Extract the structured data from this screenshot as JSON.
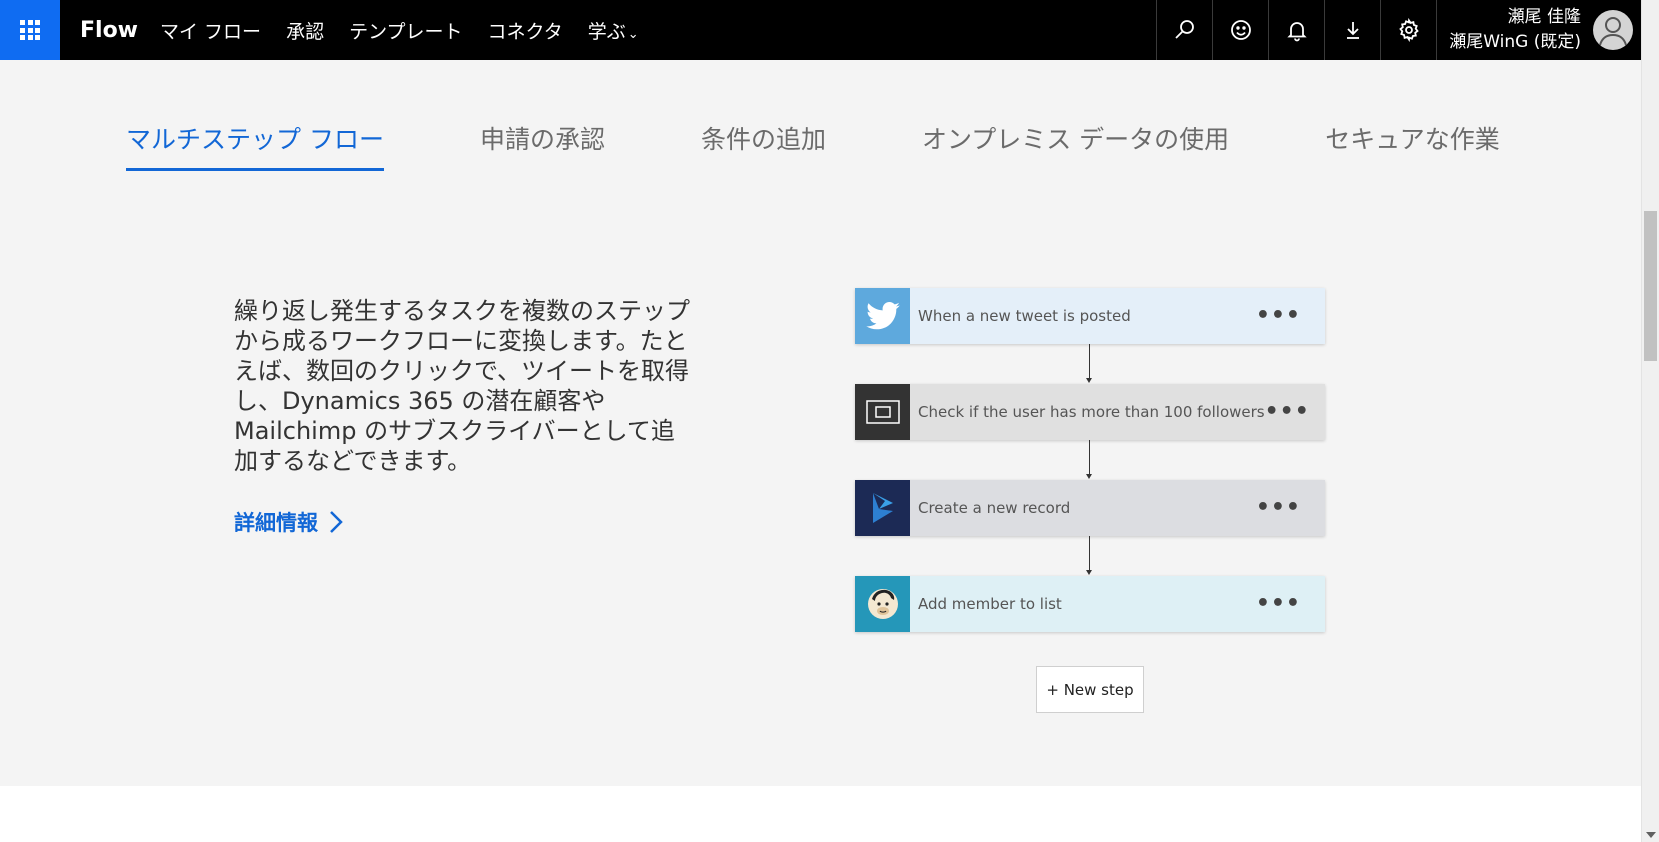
{
  "header": {
    "brand": "Flow",
    "nav": [
      {
        "label": "マイ フロー"
      },
      {
        "label": "承認"
      },
      {
        "label": "テンプレート"
      },
      {
        "label": "コネクタ"
      },
      {
        "label": "学ぶ",
        "has_dropdown": true
      }
    ],
    "icons": [
      "search-icon",
      "smiley-icon",
      "bell-icon",
      "download-icon",
      "gear-icon"
    ],
    "user": {
      "name": "瀬尾 佳隆",
      "org": "瀬尾WinG (既定)"
    },
    "colors": {
      "bar": "#000000",
      "waffle": "#0f6cf2"
    }
  },
  "tabs": [
    {
      "label": "マルチステップ フロー",
      "active": true
    },
    {
      "label": "申請の承認",
      "active": false
    },
    {
      "label": "条件の追加",
      "active": false
    },
    {
      "label": "オンプレミス データの使用",
      "active": false
    },
    {
      "label": "セキュアな作業",
      "active": false
    }
  ],
  "content": {
    "description": "繰り返し発生するタスクを複数のステップから成るワークフローに変換します。たとえば、数回のクリックで、ツイートを取得し、Dynamics 365 の潜在顧客や Mailchimp のサブスクライバーとして追加するなどできます。",
    "more_link": "詳細情報"
  },
  "flow": {
    "steps": [
      {
        "label": "When a new tweet is posted",
        "icon": "twitter-icon",
        "icon_bg": "#5ea9dd",
        "bg": "#e4eff9"
      },
      {
        "label": "Check if the user has more than 100 followers",
        "icon": "condition-icon",
        "icon_bg": "#333333",
        "bg": "#e0e0e0"
      },
      {
        "label": "Create a new record",
        "icon": "dynamics-icon",
        "icon_bg": "#1c2a55",
        "bg": "#dcdde1"
      },
      {
        "label": "Add member to list",
        "icon": "mailchimp-icon",
        "icon_bg": "#2597b9",
        "bg": "#def0f5"
      }
    ],
    "more_glyph": "•••",
    "new_step": "+ New step"
  }
}
